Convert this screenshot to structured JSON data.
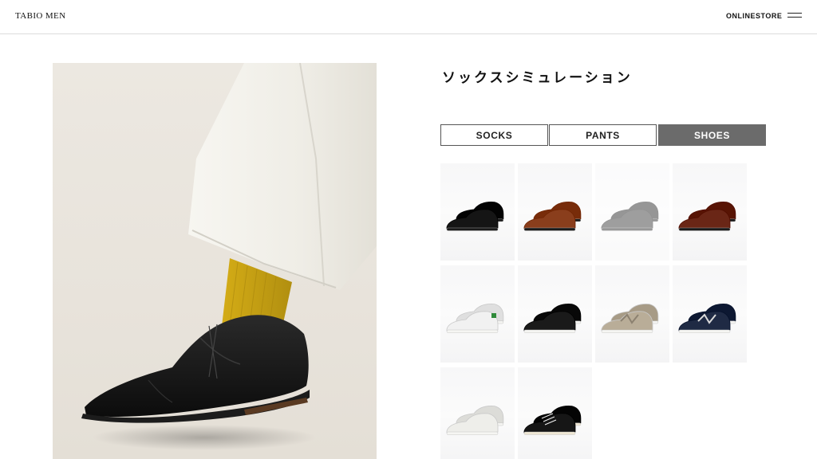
{
  "header": {
    "logo": "TABIO MEN",
    "store_link": "ONLINESTORE",
    "menu_icon": "hamburger-menu-icon"
  },
  "hero": {
    "image": "leg-with-yellow-sock-and-black-oxford-shoe",
    "colors": {
      "sock": "#c9a41a",
      "pants": "#f2f0ea",
      "shoe": "#141414",
      "background": "#e9e5de"
    }
  },
  "main": {
    "title": "ソックスシミュレーション",
    "tabs": [
      {
        "label": "SOCKS",
        "active": false
      },
      {
        "label": "PANTS",
        "active": false
      },
      {
        "label": "SHOES",
        "active": true
      }
    ],
    "shoes": [
      {
        "name": "black-loafer",
        "color": "#151515",
        "style": "loafer",
        "dimmed": false
      },
      {
        "name": "brown-loafer",
        "color": "#8a3e1c",
        "style": "loafer",
        "dimmed": false
      },
      {
        "name": "dark-gray-oxford",
        "color": "#2b2b2b",
        "style": "oxford",
        "dimmed": true
      },
      {
        "name": "brown-oxford",
        "color": "#6a2616",
        "style": "oxford",
        "dimmed": false
      },
      {
        "name": "white-green-sneaker",
        "color": "#f1f1f1",
        "style": "sneaker",
        "dimmed": false
      },
      {
        "name": "black-sneaker",
        "color": "#1a1a1a",
        "style": "sneaker",
        "dimmed": false
      },
      {
        "name": "beige-running-sneaker",
        "color": "#b9ad98",
        "style": "runner",
        "dimmed": false
      },
      {
        "name": "navy-running-sneaker",
        "color": "#1f2a44",
        "style": "runner",
        "dimmed": false
      },
      {
        "name": "white-leather-sneaker",
        "color": "#eeeeea",
        "style": "sneaker",
        "dimmed": false
      },
      {
        "name": "black-canvas-sneaker",
        "color": "#161616",
        "style": "canvas",
        "dimmed": false
      }
    ]
  }
}
